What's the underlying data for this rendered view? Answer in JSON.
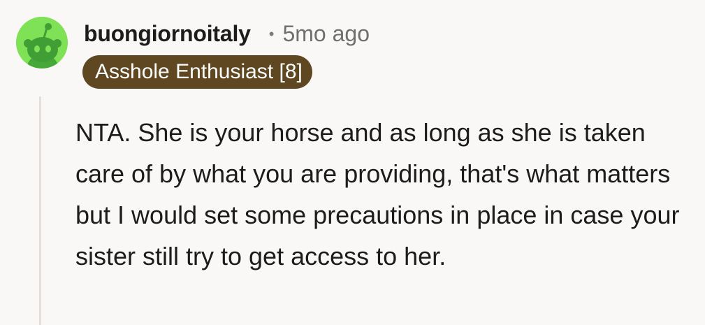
{
  "comment": {
    "avatar_icon": "reddit-snoo-avatar-icon",
    "avatar_color": "#7fe156",
    "username": "buongiornoitaly",
    "separator": "•",
    "timestamp": "5mo ago",
    "flair": "Asshole Enthusiast [8]",
    "flair_color": "#5f4721",
    "body": "NTA. She is your horse and as long as she is taken care of by what you are providing, that's what matters but I would set some precautions in place in case your sister still try to get access to her."
  }
}
